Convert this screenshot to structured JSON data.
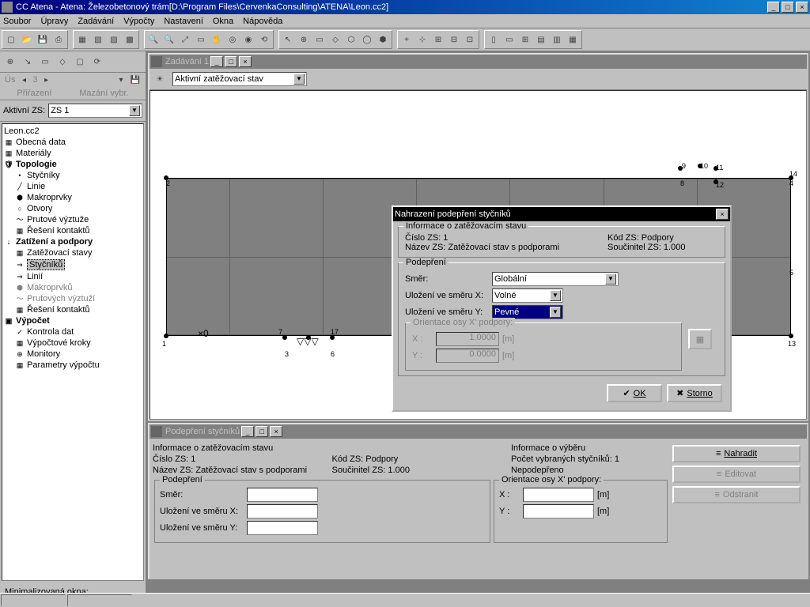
{
  "app": {
    "title": "CC Atena - Atena: Železobetonový trám[D:\\Program Files\\CervenkaConsulting\\ATENA\\Leon.cc2]"
  },
  "menu": [
    "Soubor",
    "Úpravy",
    "Zadávání",
    "Výpočty",
    "Nastavení",
    "Okna",
    "Nápověda"
  ],
  "left": {
    "prirazeni": "Přiřazení",
    "mazani": "Mazání vybr.",
    "us_label": "Ús",
    "us_val": "3",
    "active_zs_label": "Aktivní ZS:",
    "active_zs_value": "ZS 1",
    "tree_root": "Leon.cc2",
    "tree": {
      "obecna": "Obecná data",
      "materialy": "Materiály",
      "topologie": "Topologie",
      "stycniky": "Styčníky",
      "linie": "Linie",
      "makroprvky": "Makroprvky",
      "otvory": "Otvory",
      "prutove": "Prutové výztuže",
      "reseni_k": "Řešení kontaktů",
      "zatizeni": "Zatížení a podpory",
      "zat_stavy": "Zatěžovací stavy",
      "stycniku": "Styčníků",
      "linii": "Linií",
      "makroprvku": "Makroprvků",
      "prut_vyzt": "Prutových výztuží",
      "reseni_k2": "Řešení kontaktů",
      "vypocet": "Výpočet",
      "kontrola": "Kontrola dat",
      "kroky": "Výpočtové kroky",
      "monitory": "Monitory",
      "parametry": "Parametry výpočtu"
    },
    "min_okna": "Minimalizovaná okna:"
  },
  "zadavani": {
    "title": "Zadávání 1",
    "combo": "Aktivní zatěžovací stav"
  },
  "dialog": {
    "title": "Nahrazení podepření styčníků",
    "info_title": "Informace o zatěžovacím stavu",
    "cislo": "Číslo ZS: 1",
    "kod": "Kód ZS: Podpory",
    "nazev": "Název ZS: Zatěžovací stav s podporami",
    "soucinitel": "Součinitel ZS: 1.000",
    "podepreni_title": "Podepření",
    "smer": "Směr:",
    "smer_val": "Globální",
    "ulozX": "Uložení ve směru X:",
    "ulozX_val": "Volné",
    "ulozY": "Uložení ve směru Y:",
    "ulozY_val": "Pevné",
    "orient_title": "Orientace osy X' podpory:",
    "x_label": "X :",
    "x_val": "1.0000",
    "y_label": "Y :",
    "y_val": "0.0000",
    "unit": "[m]",
    "ok": "OK",
    "storno": "Storno"
  },
  "bottom": {
    "title": "Podepření styčníků",
    "info_title": "Informace o zatěžovacím stavu",
    "cislo": "Číslo ZS: 1",
    "kod": "Kód ZS: Podpory",
    "nazev": "Název ZS: Zatěžovací stav s podporami",
    "soucinitel": "Součinitel ZS: 1.000",
    "vyber_title": "Informace o výběru",
    "pocet": "Počet vybraných styčníků: 1",
    "nepodepreno": "Nepodepřeno",
    "podepreni": "Podepření",
    "smer": "Směr:",
    "ulozX": "Uložení ve směru X:",
    "ulozY": "Uložení ve směru Y:",
    "orient": "Orientace osy X' podpory:",
    "x": "X :",
    "y": "Y :",
    "unit": "[m]",
    "nahradit": "Nahradit",
    "editovat": "Editovat",
    "odstranit": "Odstranit"
  }
}
